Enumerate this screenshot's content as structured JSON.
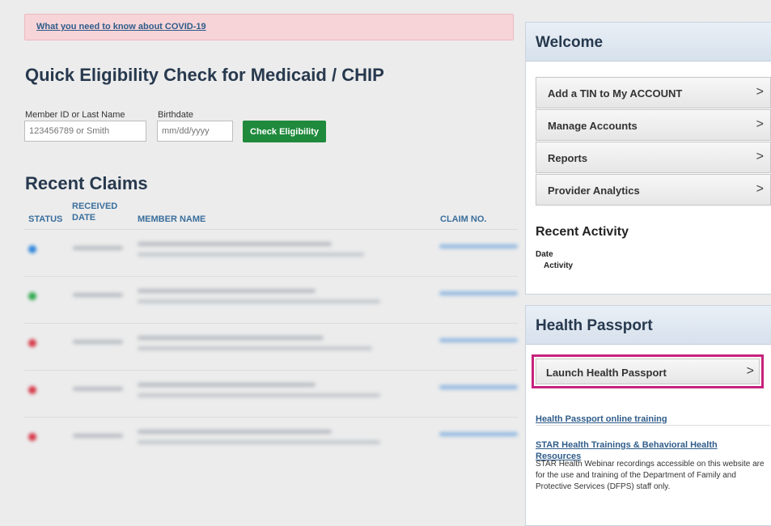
{
  "banner": {
    "covid_link": "What you need to know about COVID-19"
  },
  "eligibility": {
    "title": "Quick Eligibility Check for Medicaid / CHIP",
    "member_label": "Member ID or Last Name",
    "member_placeholder": "123456789 or Smith",
    "birthdate_label": "Birthdate",
    "birthdate_placeholder": "mm/dd/yyyy",
    "check_button": "Check Eligibility"
  },
  "claims": {
    "title": "Recent Claims",
    "columns": {
      "status": "STATUS",
      "received_date": "RECEIVED\nDATE",
      "member_name": "MEMBER NAME",
      "claim_no": "CLAIM NO."
    },
    "rows": [
      {
        "status_color": "#2e86d9"
      },
      {
        "status_color": "#2fa84f"
      },
      {
        "status_color": "#d63a4a"
      },
      {
        "status_color": "#d63a4a"
      },
      {
        "status_color": "#d63a4a"
      }
    ]
  },
  "welcome": {
    "title": "Welcome",
    "items": [
      {
        "label": "Add a TIN to My ACCOUNT",
        "arrow": ">"
      },
      {
        "label": "Manage Accounts",
        "arrow": ">"
      },
      {
        "label": "Reports",
        "arrow": ">"
      },
      {
        "label": "Provider Analytics",
        "arrow": ">"
      }
    ],
    "recent_activity_title": "Recent Activity",
    "date_label": "Date",
    "activity_label": "Activity"
  },
  "health_passport": {
    "title": "Health Passport",
    "launch_button": "Launch Health Passport",
    "launch_arrow": ">",
    "online_training_link": "Health Passport online training",
    "star_link": "STAR Health Trainings & Behavioral Health Resources",
    "star_description": "STAR Health Webinar recordings accessible on this website are for the use and training of the Department of Family and Protective Services (DFPS) staff only."
  },
  "colors": {
    "accent_green": "#1f8a3c",
    "highlight_magenta": "#c6237d",
    "link_blue": "#2f5c8a",
    "heading_navy": "#27394e"
  }
}
